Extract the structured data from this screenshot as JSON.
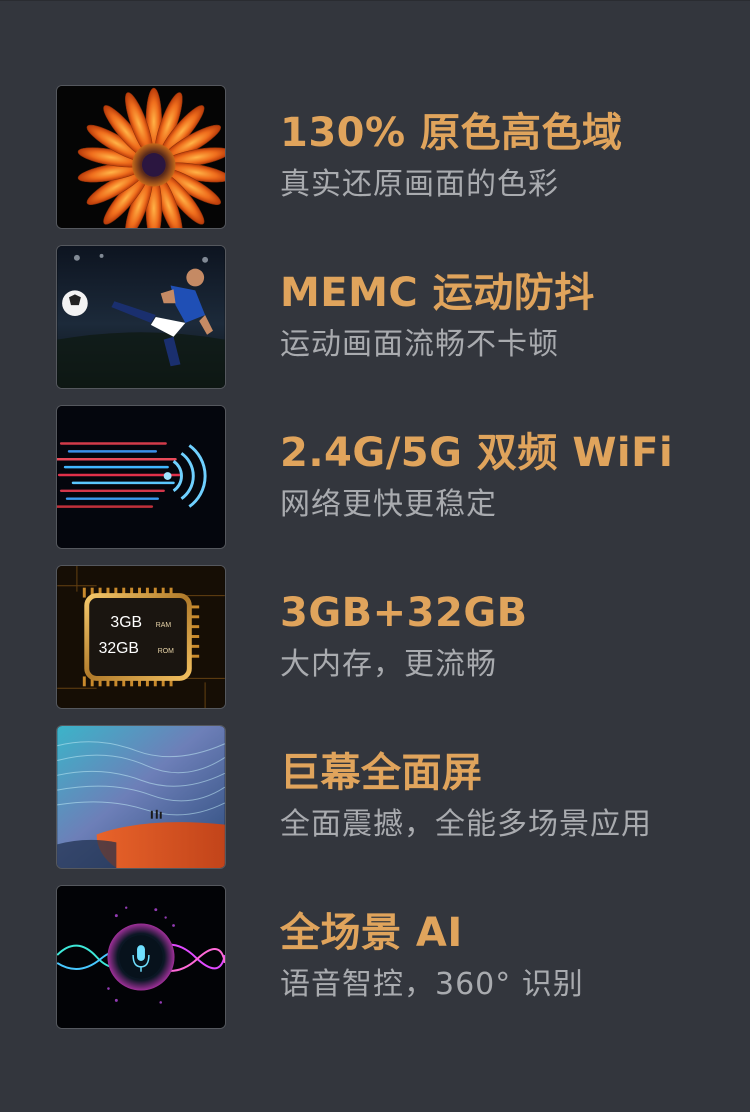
{
  "features": [
    {
      "title": "130% 原色高色域",
      "subtitle": "真实还原画面的色彩",
      "icon": "flower-image"
    },
    {
      "title": "MEMC 运动防抖",
      "subtitle": "运动画面流畅不卡顿",
      "icon": "soccer-player-image"
    },
    {
      "title": "2.4G/5G 双频 WiFi",
      "subtitle": "网络更快更稳定",
      "icon": "wifi-signal-image"
    },
    {
      "title": "3GB+32GB",
      "subtitle": "大内存，更流畅",
      "icon": "memory-chip-image",
      "chip": {
        "ram_value": "3GB",
        "ram_label": "RAM",
        "rom_value": "32GB",
        "rom_label": "ROM"
      }
    },
    {
      "title": "巨幕全面屏",
      "subtitle": "全面震撼，全能多场景应用",
      "icon": "landscape-image"
    },
    {
      "title": "全场景 AI",
      "subtitle": "语音智控，360° 识别",
      "icon": "voice-microphone-image"
    }
  ],
  "colors": {
    "background": "#33363d",
    "title": "#e0a45c",
    "subtitle": "#a9abaf"
  }
}
